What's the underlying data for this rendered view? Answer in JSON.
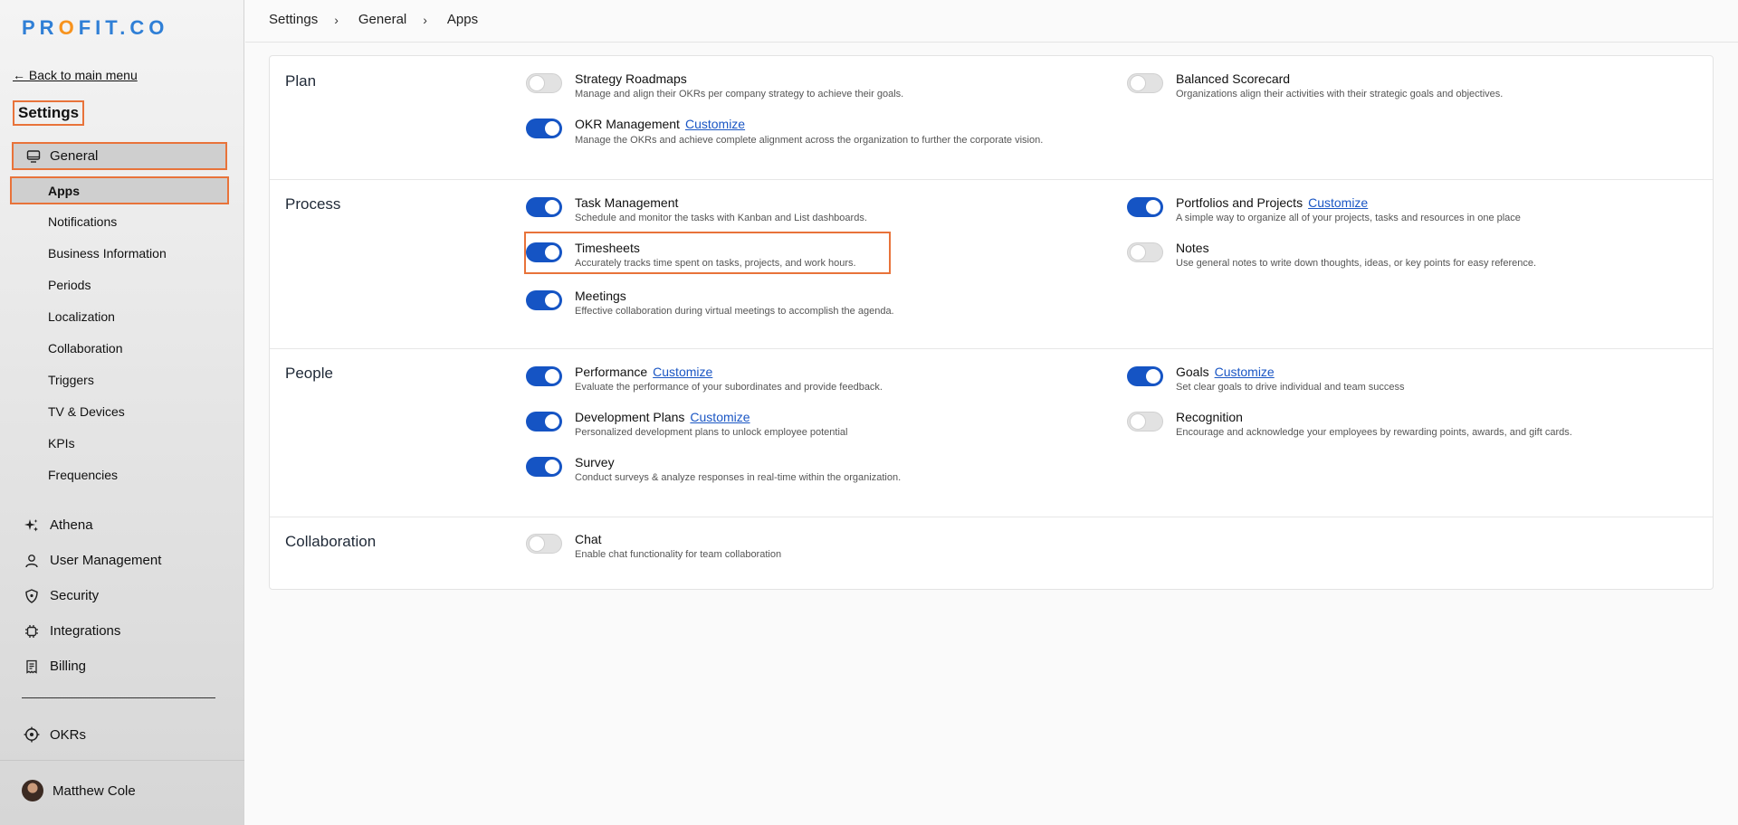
{
  "brand": {
    "logo_text": "PROFIT.CO"
  },
  "sidebar": {
    "back_label": "← Back to main menu",
    "title": "Settings",
    "general_label": "General",
    "apps_label": "Apps",
    "sub_items": [
      "Notifications",
      "Business Information",
      "Periods",
      "Localization",
      "Collaboration",
      "Triggers",
      "TV & Devices",
      "KPIs",
      "Frequencies"
    ],
    "main_items": [
      "Athena",
      "User Management",
      "Security",
      "Integrations",
      "Billing"
    ],
    "okrs_label": "OKRs",
    "user_name": "Matthew Cole"
  },
  "breadcrumb": [
    "Settings",
    "General",
    "Apps"
  ],
  "customize_label": "Customize",
  "sections": {
    "plan": {
      "title": "Plan",
      "apps": [
        {
          "name": "Strategy Roadmaps",
          "desc": "Manage and align their OKRs per company strategy to achieve their goals.",
          "enabled": false
        },
        {
          "name": "Balanced Scorecard",
          "desc": "Organizations align their activities with their strategic goals and objectives.",
          "enabled": false
        },
        {
          "name": "OKR Management",
          "desc": "Manage the OKRs and achieve complete alignment across the organization to further the corporate vision.",
          "enabled": true
        }
      ]
    },
    "process": {
      "title": "Process",
      "apps": [
        {
          "name": "Task Management",
          "desc": "Schedule and monitor the tasks with Kanban and List dashboards.",
          "enabled": true
        },
        {
          "name": "Portfolios and Projects",
          "desc": "A simple way to organize all of your projects, tasks and resources in one place",
          "enabled": true
        },
        {
          "name": "Timesheets",
          "desc": "Accurately tracks time spent on tasks, projects, and work hours.",
          "enabled": true
        },
        {
          "name": "Notes",
          "desc": "Use general notes to write down thoughts, ideas, or key points for easy reference.",
          "enabled": false
        },
        {
          "name": "Meetings",
          "desc": "Effective collaboration during virtual meetings to accomplish the agenda.",
          "enabled": true
        }
      ]
    },
    "people": {
      "title": "People",
      "apps": [
        {
          "name": "Performance",
          "desc": "Evaluate the performance of your subordinates and provide feedback.",
          "enabled": true
        },
        {
          "name": "Goals",
          "desc": "Set clear goals to drive individual and team success",
          "enabled": true
        },
        {
          "name": "Development Plans",
          "desc": "Personalized development plans to unlock employee potential",
          "enabled": true
        },
        {
          "name": "Recognition",
          "desc": "Encourage and acknowledge your employees by rewarding points, awards, and gift cards.",
          "enabled": false
        },
        {
          "name": "Survey",
          "desc": "Conduct surveys & analyze responses in real-time within the organization.",
          "enabled": true
        }
      ]
    },
    "collaboration": {
      "title": "Collaboration",
      "apps": [
        {
          "name": "Chat",
          "desc": "Enable chat functionality for team collaboration",
          "enabled": false
        }
      ]
    }
  },
  "colors": {
    "toggle_on": "#1554c4",
    "highlight": "#e8733a",
    "link": "#1a56c4"
  }
}
